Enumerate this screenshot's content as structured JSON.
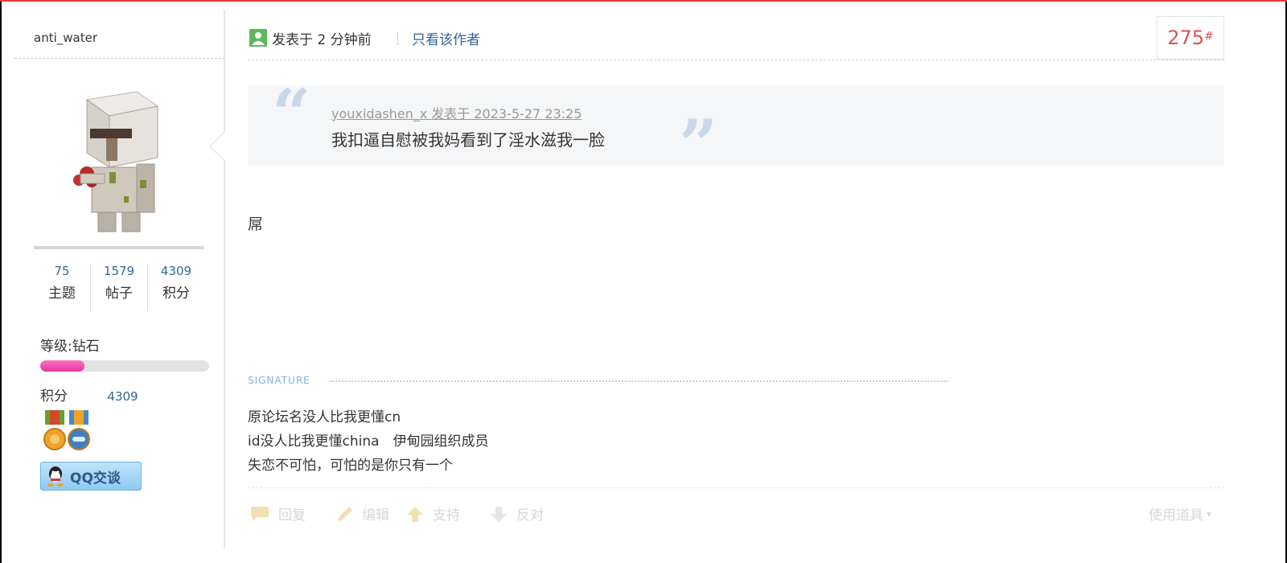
{
  "author": {
    "name": "anti_water",
    "stats": [
      {
        "value": "75",
        "label": "主题"
      },
      {
        "value": "1579",
        "label": "帖子"
      },
      {
        "value": "4309",
        "label": "积分"
      }
    ],
    "level_text": "等级:钻石",
    "level_progress": 0.26,
    "points_label": "积分",
    "points_value": "4309",
    "qq_label": "QQ交谈"
  },
  "post": {
    "posted_at": "发表于 2 分钟前",
    "only_author": "只看该作者",
    "floor_number": "275",
    "floor_suffix": "#",
    "quote": {
      "meta": "youxidashen_x 发表于 2023-5-27 23:25",
      "text": "我扣逼自慰被我妈看到了淫水滋我一脸"
    },
    "body": "屌",
    "signature_title": "SIGNATURE",
    "signature_lines": [
      "原论坛名没人比我更懂cn",
      "id没人比我更懂china　伊甸园组织成员",
      "失恋不可怕，可怕的是你只有一个"
    ]
  },
  "actions": {
    "reply": "回复",
    "edit": "编辑",
    "support": "支持",
    "oppose": "反对",
    "use_tools": "使用道具"
  },
  "colors": {
    "accent_blue": "#336699",
    "floor_red": "#d9534f",
    "level_pink": "#e036a2",
    "top_bar": "#e23d3d"
  }
}
